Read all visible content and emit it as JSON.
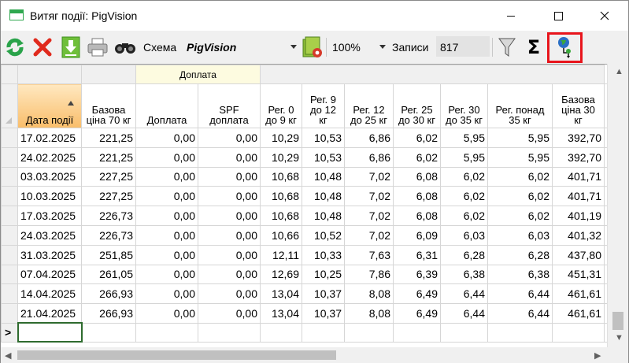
{
  "window": {
    "title": "Витяг події: PigVision",
    "controls": [
      "minimize",
      "maximize",
      "close"
    ]
  },
  "toolbar": {
    "scheme_label": "Схема",
    "scheme_value": "PigVision",
    "zoom_value": "100%",
    "records_label": "Записи",
    "records_value": "817",
    "icons": [
      "refresh-icon",
      "delete-icon",
      "download-icon",
      "print-icon",
      "binoculars-icon",
      "scheme-settings-icon",
      "filter-icon",
      "sum-icon",
      "globe-pin-icon"
    ],
    "sum_symbol": "Σ",
    "highlight_color": "#e8151c"
  },
  "grid": {
    "group_header": "Доплата",
    "columns": [
      "Дата події",
      "Базова ціна 70 кг",
      "Доплата",
      "SPF доплата",
      "Рег. 0 до 9 кг",
      "Рег. 9 до 12 кг",
      "Рег. 12 до 25 кг",
      "Рег. 25 до 30 кг",
      "Рег. 30 до 35 кг",
      "Рег. понад 35 кг",
      "Базова ціна 30 кг"
    ],
    "header_lines": [
      [
        "Дата події"
      ],
      [
        "Базова",
        "ціна 70 кг"
      ],
      [
        "Доплата"
      ],
      [
        "SPF",
        "доплата"
      ],
      [
        "Рег. 0",
        "до 9 кг"
      ],
      [
        "Рег. 9",
        "до 12",
        "кг"
      ],
      [
        "Рег. 12",
        "до 25 кг"
      ],
      [
        "Рег. 25",
        "до 30 кг"
      ],
      [
        "Рег. 30",
        "до 35 кг"
      ],
      [
        "Рег. понад",
        "35 кг"
      ],
      [
        "Базова",
        "ціна 30",
        "кг"
      ]
    ],
    "rows": [
      [
        "17.02.2025",
        "221,25",
        "0,00",
        "0,00",
        "10,29",
        "10,53",
        "6,86",
        "6,02",
        "5,95",
        "5,95",
        "392,70"
      ],
      [
        "24.02.2025",
        "221,25",
        "0,00",
        "0,00",
        "10,29",
        "10,53",
        "6,86",
        "6,02",
        "5,95",
        "5,95",
        "392,70"
      ],
      [
        "03.03.2025",
        "227,25",
        "0,00",
        "0,00",
        "10,68",
        "10,48",
        "7,02",
        "6,08",
        "6,02",
        "6,02",
        "401,71"
      ],
      [
        "10.03.2025",
        "227,25",
        "0,00",
        "0,00",
        "10,68",
        "10,48",
        "7,02",
        "6,08",
        "6,02",
        "6,02",
        "401,71"
      ],
      [
        "17.03.2025",
        "226,73",
        "0,00",
        "0,00",
        "10,68",
        "10,48",
        "7,02",
        "6,08",
        "6,02",
        "6,02",
        "401,19"
      ],
      [
        "24.03.2025",
        "226,73",
        "0,00",
        "0,00",
        "10,66",
        "10,52",
        "7,02",
        "6,09",
        "6,03",
        "6,03",
        "401,32"
      ],
      [
        "31.03.2025",
        "251,85",
        "0,00",
        "0,00",
        "12,11",
        "10,33",
        "7,63",
        "6,31",
        "6,28",
        "6,28",
        "437,80"
      ],
      [
        "07.04.2025",
        "261,05",
        "0,00",
        "0,00",
        "12,69",
        "10,25",
        "7,86",
        "6,39",
        "6,38",
        "6,38",
        "451,31"
      ],
      [
        "14.04.2025",
        "266,93",
        "0,00",
        "0,00",
        "13,04",
        "10,37",
        "8,08",
        "6,49",
        "6,44",
        "6,44",
        "461,61"
      ],
      [
        "21.04.2025",
        "266,93",
        "0,00",
        "0,00",
        "13,04",
        "10,37",
        "8,08",
        "6,49",
        "6,44",
        "6,44",
        "461,61"
      ]
    ],
    "new_row_marker": ">",
    "sorted_column_color": "#f9bd6a",
    "group_header_color": "#fdfbe0"
  }
}
